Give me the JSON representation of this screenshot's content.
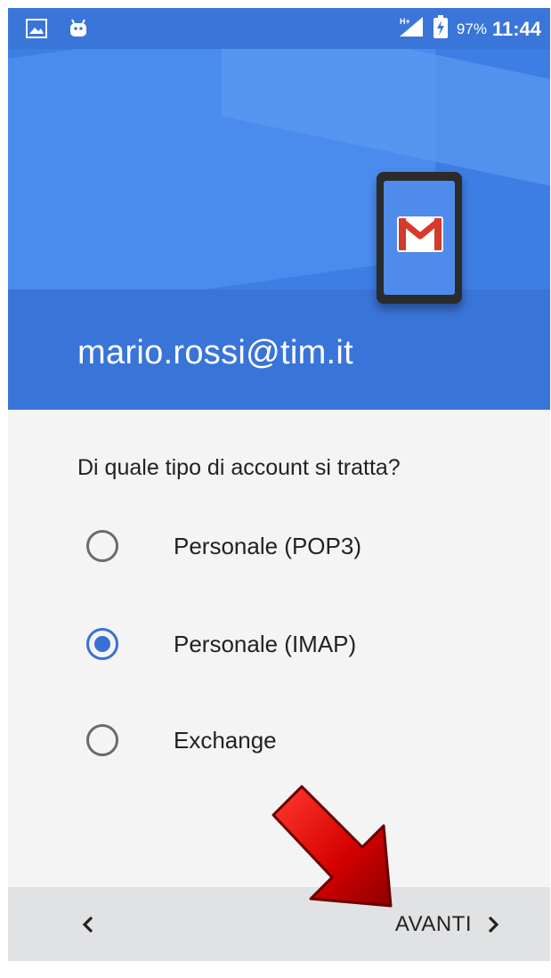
{
  "status_bar": {
    "battery_percent": "97%",
    "time": "11:44",
    "network": "H+",
    "icons": [
      "gallery-icon",
      "android-icon",
      "signal-icon",
      "battery-charging-icon"
    ]
  },
  "header": {
    "email": "mario.rossi@tim.it",
    "illustration": "gmail-phone-icon"
  },
  "content": {
    "question": "Di quale tipo di account si tratta?",
    "options": [
      {
        "label": "Personale (POP3)",
        "selected": false
      },
      {
        "label": "Personale (IMAP)",
        "selected": true
      },
      {
        "label": "Exchange",
        "selected": false
      }
    ]
  },
  "annotation": {
    "icon": "red-arrow-icon",
    "color": "#cc0000"
  },
  "bottom_bar": {
    "back_icon": "chevron-left-icon",
    "next_label": "AVANTI",
    "next_icon": "chevron-right-icon"
  },
  "colors": {
    "status_bar": "#3a75d9",
    "header": "#3d7ee5",
    "accent": "#3a6fd6",
    "background": "#f4f4f4",
    "bottom_bar": "#e1e2e4"
  }
}
